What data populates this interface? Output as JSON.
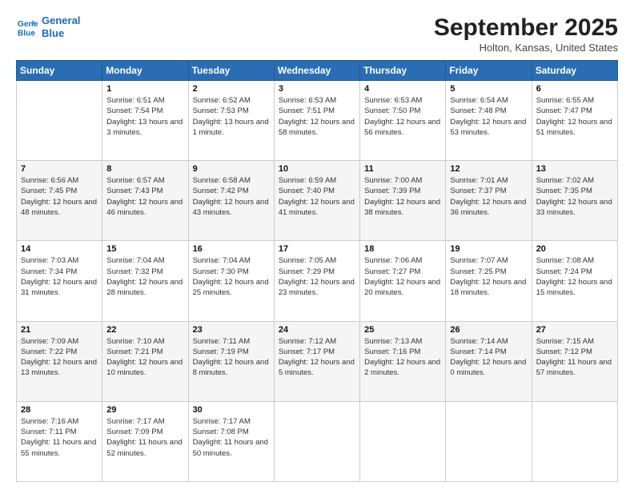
{
  "logo": {
    "line1": "General",
    "line2": "Blue"
  },
  "title": "September 2025",
  "subtitle": "Holton, Kansas, United States",
  "weekdays": [
    "Sunday",
    "Monday",
    "Tuesday",
    "Wednesday",
    "Thursday",
    "Friday",
    "Saturday"
  ],
  "weeks": [
    [
      {
        "day": "",
        "sunrise": "",
        "sunset": "",
        "daylight": ""
      },
      {
        "day": "1",
        "sunrise": "Sunrise: 6:51 AM",
        "sunset": "Sunset: 7:54 PM",
        "daylight": "Daylight: 13 hours and 3 minutes."
      },
      {
        "day": "2",
        "sunrise": "Sunrise: 6:52 AM",
        "sunset": "Sunset: 7:53 PM",
        "daylight": "Daylight: 13 hours and 1 minute."
      },
      {
        "day": "3",
        "sunrise": "Sunrise: 6:53 AM",
        "sunset": "Sunset: 7:51 PM",
        "daylight": "Daylight: 12 hours and 58 minutes."
      },
      {
        "day": "4",
        "sunrise": "Sunrise: 6:53 AM",
        "sunset": "Sunset: 7:50 PM",
        "daylight": "Daylight: 12 hours and 56 minutes."
      },
      {
        "day": "5",
        "sunrise": "Sunrise: 6:54 AM",
        "sunset": "Sunset: 7:48 PM",
        "daylight": "Daylight: 12 hours and 53 minutes."
      },
      {
        "day": "6",
        "sunrise": "Sunrise: 6:55 AM",
        "sunset": "Sunset: 7:47 PM",
        "daylight": "Daylight: 12 hours and 51 minutes."
      }
    ],
    [
      {
        "day": "7",
        "sunrise": "Sunrise: 6:56 AM",
        "sunset": "Sunset: 7:45 PM",
        "daylight": "Daylight: 12 hours and 48 minutes."
      },
      {
        "day": "8",
        "sunrise": "Sunrise: 6:57 AM",
        "sunset": "Sunset: 7:43 PM",
        "daylight": "Daylight: 12 hours and 46 minutes."
      },
      {
        "day": "9",
        "sunrise": "Sunrise: 6:58 AM",
        "sunset": "Sunset: 7:42 PM",
        "daylight": "Daylight: 12 hours and 43 minutes."
      },
      {
        "day": "10",
        "sunrise": "Sunrise: 6:59 AM",
        "sunset": "Sunset: 7:40 PM",
        "daylight": "Daylight: 12 hours and 41 minutes."
      },
      {
        "day": "11",
        "sunrise": "Sunrise: 7:00 AM",
        "sunset": "Sunset: 7:39 PM",
        "daylight": "Daylight: 12 hours and 38 minutes."
      },
      {
        "day": "12",
        "sunrise": "Sunrise: 7:01 AM",
        "sunset": "Sunset: 7:37 PM",
        "daylight": "Daylight: 12 hours and 36 minutes."
      },
      {
        "day": "13",
        "sunrise": "Sunrise: 7:02 AM",
        "sunset": "Sunset: 7:35 PM",
        "daylight": "Daylight: 12 hours and 33 minutes."
      }
    ],
    [
      {
        "day": "14",
        "sunrise": "Sunrise: 7:03 AM",
        "sunset": "Sunset: 7:34 PM",
        "daylight": "Daylight: 12 hours and 31 minutes."
      },
      {
        "day": "15",
        "sunrise": "Sunrise: 7:04 AM",
        "sunset": "Sunset: 7:32 PM",
        "daylight": "Daylight: 12 hours and 28 minutes."
      },
      {
        "day": "16",
        "sunrise": "Sunrise: 7:04 AM",
        "sunset": "Sunset: 7:30 PM",
        "daylight": "Daylight: 12 hours and 25 minutes."
      },
      {
        "day": "17",
        "sunrise": "Sunrise: 7:05 AM",
        "sunset": "Sunset: 7:29 PM",
        "daylight": "Daylight: 12 hours and 23 minutes."
      },
      {
        "day": "18",
        "sunrise": "Sunrise: 7:06 AM",
        "sunset": "Sunset: 7:27 PM",
        "daylight": "Daylight: 12 hours and 20 minutes."
      },
      {
        "day": "19",
        "sunrise": "Sunrise: 7:07 AM",
        "sunset": "Sunset: 7:25 PM",
        "daylight": "Daylight: 12 hours and 18 minutes."
      },
      {
        "day": "20",
        "sunrise": "Sunrise: 7:08 AM",
        "sunset": "Sunset: 7:24 PM",
        "daylight": "Daylight: 12 hours and 15 minutes."
      }
    ],
    [
      {
        "day": "21",
        "sunrise": "Sunrise: 7:09 AM",
        "sunset": "Sunset: 7:22 PM",
        "daylight": "Daylight: 12 hours and 13 minutes."
      },
      {
        "day": "22",
        "sunrise": "Sunrise: 7:10 AM",
        "sunset": "Sunset: 7:21 PM",
        "daylight": "Daylight: 12 hours and 10 minutes."
      },
      {
        "day": "23",
        "sunrise": "Sunrise: 7:11 AM",
        "sunset": "Sunset: 7:19 PM",
        "daylight": "Daylight: 12 hours and 8 minutes."
      },
      {
        "day": "24",
        "sunrise": "Sunrise: 7:12 AM",
        "sunset": "Sunset: 7:17 PM",
        "daylight": "Daylight: 12 hours and 5 minutes."
      },
      {
        "day": "25",
        "sunrise": "Sunrise: 7:13 AM",
        "sunset": "Sunset: 7:16 PM",
        "daylight": "Daylight: 12 hours and 2 minutes."
      },
      {
        "day": "26",
        "sunrise": "Sunrise: 7:14 AM",
        "sunset": "Sunset: 7:14 PM",
        "daylight": "Daylight: 12 hours and 0 minutes."
      },
      {
        "day": "27",
        "sunrise": "Sunrise: 7:15 AM",
        "sunset": "Sunset: 7:12 PM",
        "daylight": "Daylight: 11 hours and 57 minutes."
      }
    ],
    [
      {
        "day": "28",
        "sunrise": "Sunrise: 7:16 AM",
        "sunset": "Sunset: 7:11 PM",
        "daylight": "Daylight: 11 hours and 55 minutes."
      },
      {
        "day": "29",
        "sunrise": "Sunrise: 7:17 AM",
        "sunset": "Sunset: 7:09 PM",
        "daylight": "Daylight: 11 hours and 52 minutes."
      },
      {
        "day": "30",
        "sunrise": "Sunrise: 7:17 AM",
        "sunset": "Sunset: 7:08 PM",
        "daylight": "Daylight: 11 hours and 50 minutes."
      },
      {
        "day": "",
        "sunrise": "",
        "sunset": "",
        "daylight": ""
      },
      {
        "day": "",
        "sunrise": "",
        "sunset": "",
        "daylight": ""
      },
      {
        "day": "",
        "sunrise": "",
        "sunset": "",
        "daylight": ""
      },
      {
        "day": "",
        "sunrise": "",
        "sunset": "",
        "daylight": ""
      }
    ]
  ]
}
